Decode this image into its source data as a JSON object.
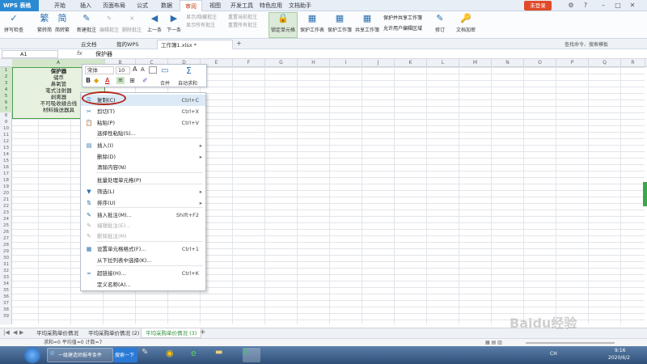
{
  "app": {
    "logo": "WPS 表格",
    "menu_tabs": [
      "开始",
      "插入",
      "页面布局",
      "公式",
      "数据",
      "审阅",
      "视图",
      "开发工具",
      "特色应用",
      "文档助手"
    ],
    "active_menu_tab": "审阅",
    "login_label": "未登录"
  },
  "ribbon": {
    "spell": "拼写检查",
    "trad_to_simp": "繁转简",
    "simp_to_trad": "简转繁",
    "new_comment": "新建批注",
    "edit_comment": "编辑批注",
    "delete_comment": "删除批注",
    "prev": "上一条",
    "next": "下一条",
    "show_hide_comment": "显示/隐藏批注",
    "show_all_comments": "显示所有批注",
    "reset_current_comment": "重置当前批注",
    "reset_all_comments": "重置所有批注",
    "lock_cell": "锁定单元格",
    "protect_sheet": "保护工作表",
    "protect_workbook": "保护工作簿",
    "share_workbook": "共享工作簿",
    "protect_share_workbook": "保护并共享工作簿",
    "allow_user_edit": "允许用户编辑区域",
    "revise": "修订",
    "doc_encrypt": "文档加密"
  },
  "doc_tabs": [
    "云文档",
    "我的WPS",
    "工作簿1.xlsx *"
  ],
  "search_placeholder": "查找命令、搜索模板",
  "formula_bar": {
    "cell_ref": "A1",
    "fx": "fx",
    "value": "保护器"
  },
  "columns": [
    "A",
    "B",
    "C",
    "D",
    "E",
    "F",
    "G",
    "H",
    "I",
    "J",
    "K",
    "L",
    "M",
    "N",
    "O",
    "P",
    "Q",
    "R",
    "S",
    "T"
  ],
  "rows": [
    "1",
    "2",
    "3",
    "4",
    "5",
    "6",
    "7",
    "8",
    "9",
    "10",
    "11",
    "12",
    "13",
    "14",
    "15",
    "16",
    "17",
    "18",
    "19",
    "20",
    "21",
    "22",
    "23",
    "24",
    "25",
    "26",
    "27",
    "28",
    "29",
    "30",
    "31",
    "32",
    "33",
    "34",
    "35",
    "36",
    "37",
    "38",
    "39"
  ],
  "cells_A": [
    "保护器",
    "储币",
    "鼻氧管",
    "笔式注射器",
    "剥离器",
    "不可吸收缝合线",
    "材料输送器具"
  ],
  "mini_toolbar": {
    "font": "宋体",
    "size": "10",
    "merge": "合并",
    "autosum": "自动求和"
  },
  "context_menu": [
    {
      "label": "复制(C)",
      "shortcut": "Ctrl+C",
      "icon": "copy-icon",
      "glyph": "⎘"
    },
    {
      "label": "剪切(T)",
      "shortcut": "Ctrl+X",
      "icon": "scissors-icon",
      "glyph": "✂"
    },
    {
      "label": "粘贴(P)",
      "shortcut": "Ctrl+V",
      "icon": "paste-icon",
      "glyph": "📋"
    },
    {
      "label": "选择性粘贴(S)...",
      "shortcut": "",
      "icon": "paste-special-icon",
      "glyph": ""
    },
    {
      "label": "插入(I)",
      "shortcut": "",
      "icon": "insert-icon",
      "glyph": "▤",
      "arrow": true
    },
    {
      "label": "删除(D)",
      "shortcut": "",
      "icon": "",
      "glyph": "",
      "arrow": true
    },
    {
      "label": "清除内容(N)",
      "shortcut": "",
      "icon": "",
      "glyph": ""
    },
    {
      "label": "批量处理单元格(P)",
      "shortcut": "",
      "icon": "",
      "glyph": ""
    },
    {
      "label": "筛选(L)",
      "shortcut": "",
      "icon": "filter-icon",
      "glyph": "▼",
      "arrow": true
    },
    {
      "label": "排序(U)",
      "shortcut": "",
      "icon": "sort-icon",
      "glyph": "⇅",
      "arrow": true
    },
    {
      "label": "插入批注(M)...",
      "shortcut": "Shift+F2",
      "icon": "comment-icon",
      "glyph": "✎"
    },
    {
      "label": "编辑批注(E)...",
      "shortcut": "",
      "icon": "edit-comment-icon",
      "glyph": "✎",
      "disabled": true
    },
    {
      "label": "删除批注(M)",
      "shortcut": "",
      "icon": "delete-comment-icon",
      "glyph": "✎",
      "disabled": true
    },
    {
      "label": "设置单元格格式(F)...",
      "shortcut": "Ctrl+1",
      "icon": "format-cells-icon",
      "glyph": "▦"
    },
    {
      "label": "从下拉列表中选择(K)...",
      "shortcut": "",
      "icon": "",
      "glyph": ""
    },
    {
      "label": "超链接(H)...",
      "shortcut": "Ctrl+K",
      "icon": "hyperlink-icon",
      "glyph": "∞"
    },
    {
      "label": "定义名称(A)...",
      "shortcut": "",
      "icon": "",
      "glyph": ""
    }
  ],
  "sheet_tabs": [
    "平均采购单价情况",
    "平均采购单价情况 (2)",
    "平均采购单价情况 (3)"
  ],
  "active_sheet": "平均采购单价情况 (3)",
  "status": "求和=0  平均值=0  计数=7",
  "taskbar": {
    "ie_title": "一级建造师报考条件",
    "search_label": "搜索一下",
    "time": "9:16",
    "date": "2020/6/2",
    "ime": "CH"
  },
  "watermark": "Baidu经验",
  "colors": {
    "accent": "#2b8ad1",
    "selection_green": "#4a9d4a",
    "highlight_ring": "#b02a1e",
    "login": "#e04a2a"
  }
}
